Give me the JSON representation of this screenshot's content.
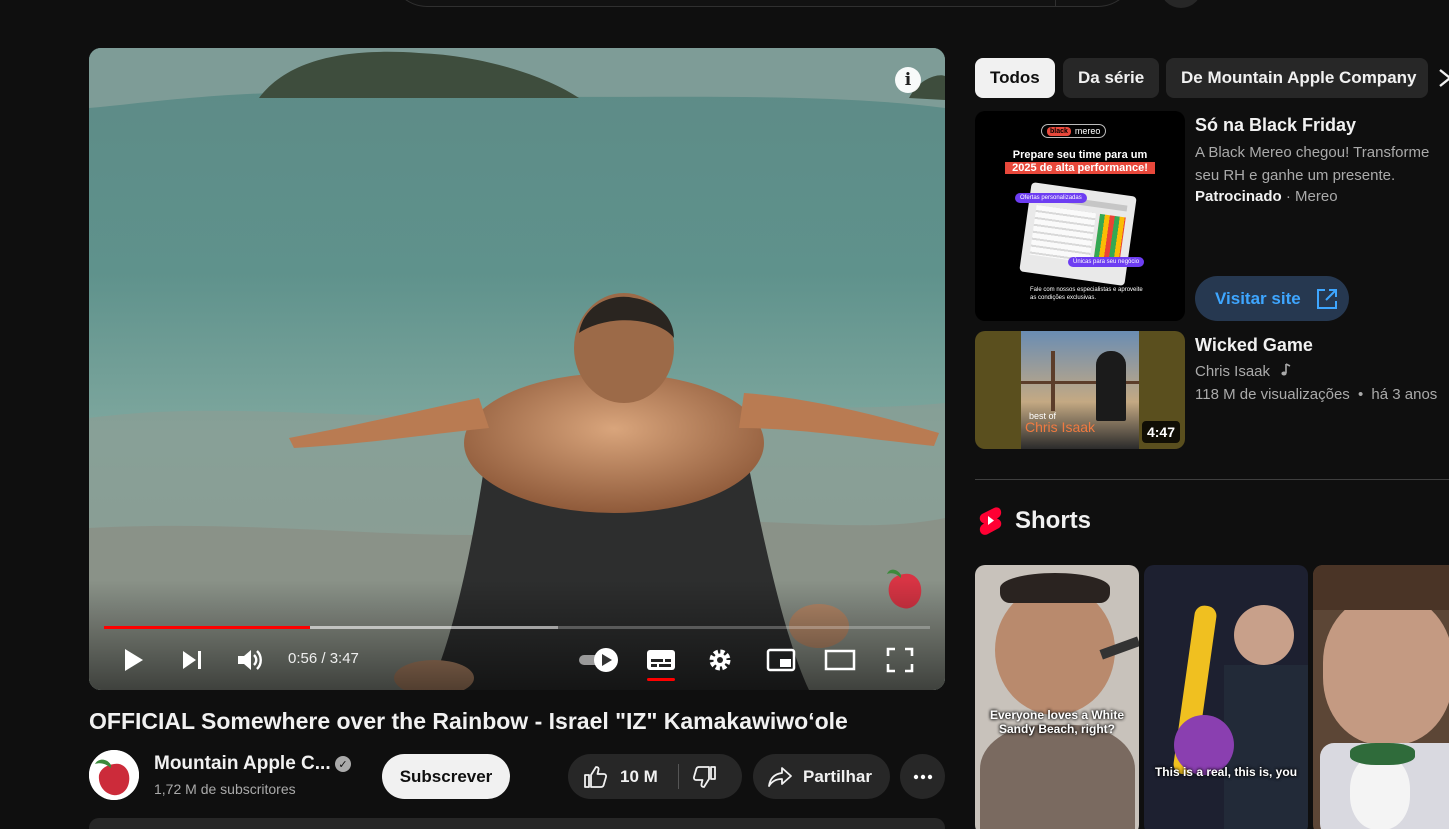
{
  "player": {
    "time": "0:56 / 3:47",
    "progress_played": 0.249,
    "progress_loaded": 0.55
  },
  "video": {
    "title": "OFFICIAL Somewhere over the Rainbow - Israel \"IZ\" Kamakawiwoʻole",
    "channel": "Mountain Apple C...",
    "subscribers": "1,72 M de subscritores",
    "subscribe_label": "Subscrever",
    "likes": "10 M",
    "share_label": "Partilhar"
  },
  "chips": [
    "Todos",
    "Da série",
    "De Mountain Apple Company"
  ],
  "ad": {
    "title": "Só na Black Friday",
    "description": "A Black Mereo chegou! Transforme seu RH e ganhe um presente.",
    "sponsored": "Patrocinado",
    "advertiser": "Mereo",
    "cta": "Visitar site",
    "thumb": {
      "brand_badge": "black",
      "brand": "mereo",
      "headline_1": "Prepare seu time para um",
      "headline_2": "2025 de alta performance!",
      "tag_1": "Ofertas personalizadas",
      "tag_2": "Únicas para seu negócio",
      "footer": "Fale com nossos especialistas e aproveite as condições exclusivas."
    }
  },
  "recommended": {
    "title": "Wicked Game",
    "channel": "Chris Isaak",
    "views": "118 M de visualizações",
    "age": "há 3 anos",
    "duration": "4:47",
    "thumb_small": "best of",
    "thumb_big": "Chris Isaak"
  },
  "shorts": {
    "heading": "Shorts",
    "items": [
      {
        "caption": "Everyone loves a White Sandy Beach, right?"
      },
      {
        "caption": "This is a real, this is, you"
      },
      {
        "caption": ""
      }
    ]
  },
  "icons": {
    "play": "play-icon",
    "next": "next-icon",
    "volume": "volume-icon",
    "autoplay": "autoplay-toggle-icon",
    "captions": "captions-icon",
    "settings": "gear-icon",
    "miniplayer": "miniplayer-icon",
    "theater": "theater-icon",
    "fullscreen": "fullscreen-icon"
  },
  "colors": {
    "accent": "#ff0000",
    "link": "#3ea6ff",
    "background": "#0f0f0f"
  }
}
